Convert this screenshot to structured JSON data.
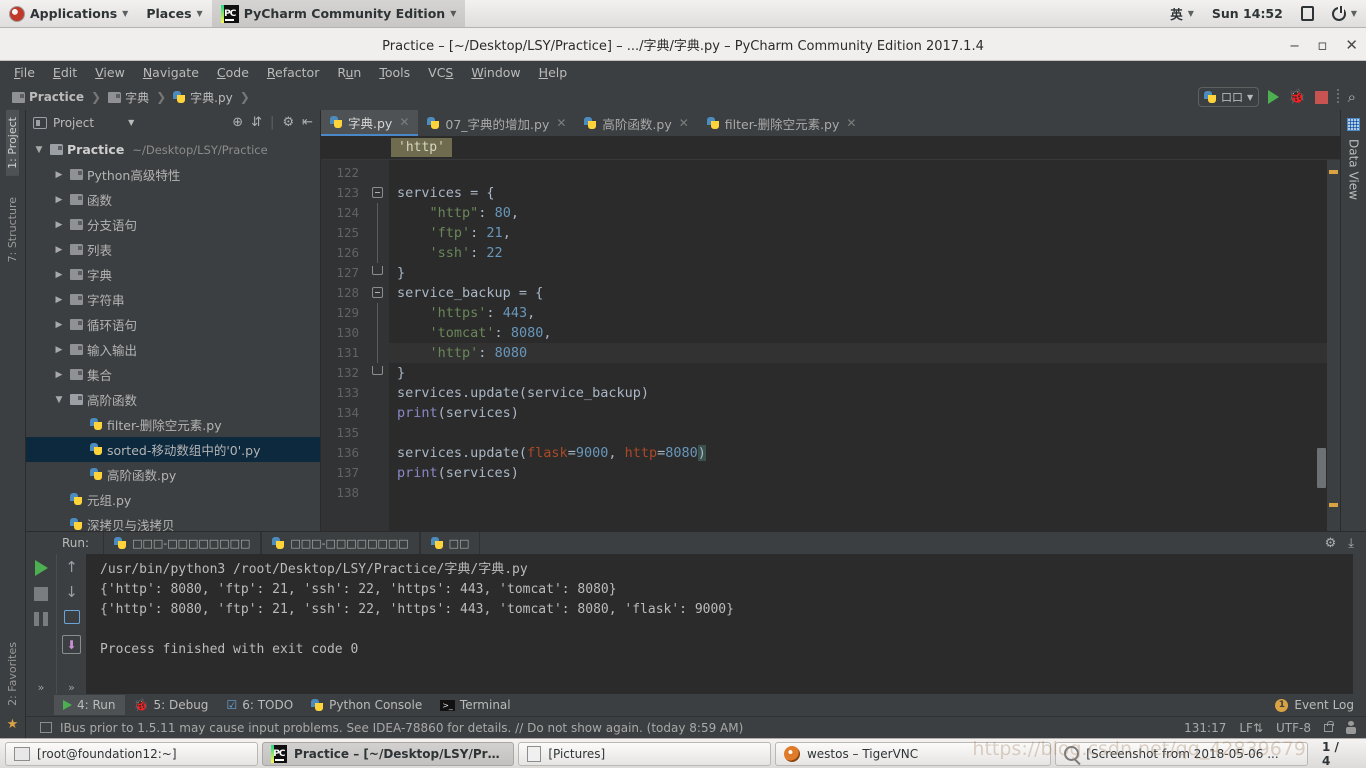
{
  "gnome_panel": {
    "applications": "Applications",
    "places": "Places",
    "app_name": "PyCharm Community Edition",
    "input_method": "英",
    "clock": "Sun 14:52"
  },
  "window": {
    "title": "Practice – [~/Desktop/LSY/Practice] – .../字典/字典.py – PyCharm Community Edition 2017.1.4",
    "minimize": "‒",
    "maximize": "▫",
    "close": "✕"
  },
  "menu": [
    {
      "label": "File",
      "accel": "F"
    },
    {
      "label": "Edit",
      "accel": "E"
    },
    {
      "label": "View",
      "accel": "V"
    },
    {
      "label": "Navigate",
      "accel": "N"
    },
    {
      "label": "Code",
      "accel": "C"
    },
    {
      "label": "Refactor",
      "accel": "R"
    },
    {
      "label": "Run",
      "accel": "u"
    },
    {
      "label": "Tools",
      "accel": "T"
    },
    {
      "label": "VCS",
      "accel": "S"
    },
    {
      "label": "Window",
      "accel": "W"
    },
    {
      "label": "Help",
      "accel": "H"
    }
  ],
  "navbar": {
    "crumbs": [
      "Practice",
      "字典",
      "字典.py"
    ],
    "separator": "❯",
    "run_config": "口口"
  },
  "left_strip": {
    "project": "1: Project",
    "structure": "7: Structure",
    "favorites": "2: Favorites"
  },
  "right_strip": {
    "data_view": "Data View"
  },
  "project_panel": {
    "title": "Project",
    "tree": [
      {
        "depth": 0,
        "arrow": "▼",
        "icon": "folder-open-icon",
        "label": "Practice",
        "suffix": "~/Desktop/LSY/Practice",
        "bold": true,
        "selected": false
      },
      {
        "depth": 1,
        "arrow": "▶",
        "icon": "folder-icon",
        "label": "Python高级特性",
        "suffix": "",
        "bold": false,
        "selected": false
      },
      {
        "depth": 1,
        "arrow": "▶",
        "icon": "folder-icon",
        "label": "函数",
        "suffix": "",
        "bold": false,
        "selected": false
      },
      {
        "depth": 1,
        "arrow": "▶",
        "icon": "folder-icon",
        "label": "分支语句",
        "suffix": "",
        "bold": false,
        "selected": false
      },
      {
        "depth": 1,
        "arrow": "▶",
        "icon": "folder-icon",
        "label": "列表",
        "suffix": "",
        "bold": false,
        "selected": false
      },
      {
        "depth": 1,
        "arrow": "▶",
        "icon": "folder-icon",
        "label": "字典",
        "suffix": "",
        "bold": false,
        "selected": false
      },
      {
        "depth": 1,
        "arrow": "▶",
        "icon": "folder-icon",
        "label": "字符串",
        "suffix": "",
        "bold": false,
        "selected": false
      },
      {
        "depth": 1,
        "arrow": "▶",
        "icon": "folder-icon",
        "label": "循环语句",
        "suffix": "",
        "bold": false,
        "selected": false
      },
      {
        "depth": 1,
        "arrow": "▶",
        "icon": "folder-icon",
        "label": "输入输出",
        "suffix": "",
        "bold": false,
        "selected": false
      },
      {
        "depth": 1,
        "arrow": "▶",
        "icon": "folder-icon",
        "label": "集合",
        "suffix": "",
        "bold": false,
        "selected": false
      },
      {
        "depth": 1,
        "arrow": "▼",
        "icon": "folder-open-icon",
        "label": "高阶函数",
        "suffix": "",
        "bold": false,
        "selected": false
      },
      {
        "depth": 2,
        "arrow": "",
        "icon": "python-file-icon",
        "label": "filter-删除空元素.py",
        "suffix": "",
        "bold": false,
        "selected": false
      },
      {
        "depth": 2,
        "arrow": "",
        "icon": "python-file-icon",
        "label": "sorted-移动数组中的'0'.py",
        "suffix": "",
        "bold": false,
        "selected": true
      },
      {
        "depth": 2,
        "arrow": "",
        "icon": "python-file-icon",
        "label": "高阶函数.py",
        "suffix": "",
        "bold": false,
        "selected": false
      },
      {
        "depth": 1,
        "arrow": "",
        "icon": "python-file-icon",
        "label": "元组.py",
        "suffix": "",
        "bold": false,
        "selected": false
      },
      {
        "depth": 1,
        "arrow": "",
        "icon": "python-file-icon",
        "label": "深拷贝与浅拷贝",
        "suffix": "",
        "bold": false,
        "selected": false
      }
    ]
  },
  "editor_tabs": [
    {
      "label": "字典.py",
      "selected": true
    },
    {
      "label": "07_字典的增加.py",
      "selected": false
    },
    {
      "label": "高阶函数.py",
      "selected": false
    },
    {
      "label": "filter-删除空元素.py",
      "selected": false
    }
  ],
  "editor_breadcrumb": "'http'",
  "code": {
    "first_line": 122,
    "lines": [
      {
        "n": 122,
        "text": "",
        "highlight": false,
        "fold": "",
        "bulb": false
      },
      {
        "n": 123,
        "text": "services = {",
        "highlight": false,
        "fold": "start",
        "bulb": false
      },
      {
        "n": 124,
        "text": "    \"http\": 80,",
        "highlight": false,
        "fold": "bar",
        "bulb": false
      },
      {
        "n": 125,
        "text": "    'ftp': 21,",
        "highlight": false,
        "fold": "bar",
        "bulb": false
      },
      {
        "n": 126,
        "text": "    'ssh': 22",
        "highlight": false,
        "fold": "bar",
        "bulb": false
      },
      {
        "n": 127,
        "text": "}",
        "highlight": false,
        "fold": "end",
        "bulb": false
      },
      {
        "n": 128,
        "text": "service_backup = {",
        "highlight": false,
        "fold": "start",
        "bulb": false
      },
      {
        "n": 129,
        "text": "    'https': 443,",
        "highlight": false,
        "fold": "bar",
        "bulb": false
      },
      {
        "n": 130,
        "text": "    'tomcat': 8080,",
        "highlight": false,
        "fold": "bar",
        "bulb": false
      },
      {
        "n": 131,
        "text": "    'http': 8080",
        "highlight": true,
        "fold": "bar",
        "bulb": true
      },
      {
        "n": 132,
        "text": "}",
        "highlight": false,
        "fold": "end",
        "bulb": false
      },
      {
        "n": 133,
        "text": "services.update(service_backup)",
        "highlight": false,
        "fold": "",
        "bulb": false
      },
      {
        "n": 134,
        "text": "print(services)",
        "highlight": false,
        "fold": "",
        "bulb": false
      },
      {
        "n": 135,
        "text": "",
        "highlight": false,
        "fold": "",
        "bulb": false
      },
      {
        "n": 136,
        "text": "services.update(flask=9000, http=8080)",
        "highlight": false,
        "fold": "",
        "bulb": false
      },
      {
        "n": 137,
        "text": "print(services)",
        "highlight": false,
        "fold": "",
        "bulb": false
      },
      {
        "n": 138,
        "text": "",
        "highlight": false,
        "fold": "",
        "bulb": false
      }
    ]
  },
  "run_window": {
    "label": "Run:",
    "tabs": [
      {
        "label": "□□□-□□□□□□□□",
        "boxes": 11
      },
      {
        "label": "□□□-□□□□□□□□",
        "boxes": 11
      },
      {
        "label": "□□",
        "boxes": 2
      }
    ],
    "console": [
      "/usr/bin/python3 /root/Desktop/LSY/Practice/字典/字典.py",
      "{'http': 8080, 'ftp': 21, 'ssh': 22, 'https': 443, 'tomcat': 8080}",
      "{'http': 8080, 'ftp': 21, 'ssh': 22, 'https': 443, 'tomcat': 8080, 'flask': 9000}",
      "",
      "Process finished with exit code 0"
    ]
  },
  "bottom_tabs": [
    {
      "label": "4: Run",
      "accel": "4",
      "icon": "run-icon",
      "selected": true
    },
    {
      "label": "5: Debug",
      "accel": "5",
      "icon": "debug-icon",
      "selected": false
    },
    {
      "label": "6: TODO",
      "accel": "6",
      "icon": "todo-icon",
      "selected": false
    },
    {
      "label": "Python Console",
      "accel": "",
      "icon": "python-icon",
      "selected": false
    },
    {
      "label": "Terminal",
      "accel": "",
      "icon": "terminal-icon",
      "selected": false
    }
  ],
  "event_log": {
    "label": "Event Log",
    "badge": "1"
  },
  "status_bar": {
    "message": "IBus prior to 1.5.11 may cause input problems. See IDEA-78860 for details. // Do not show again. (today 8:59 AM)",
    "caret": "131:17",
    "line_sep": "LF",
    "encoding": "UTF-8"
  },
  "taskbar": {
    "items": [
      {
        "label": "[root@foundation12:~]",
        "icon": "terminal-icon",
        "active": false
      },
      {
        "label": "Practice – [~/Desktop/LSY/Practi...",
        "icon": "pycharm-icon",
        "active": true
      },
      {
        "label": "[Pictures]",
        "icon": "folder-icon",
        "active": false
      },
      {
        "label": "westos – TigerVNC",
        "icon": "vnc-icon",
        "active": false
      },
      {
        "label": "[Screenshot from 2018-05-06 ...",
        "icon": "magnifier-icon",
        "active": false
      }
    ],
    "page_count": "1 / 4"
  },
  "watermark": "https://blog.csdn.net/qq_42839679",
  "colors": {
    "accent": "#4a88c7",
    "selection": "#0d293e",
    "editor_bg": "#2b2b2b",
    "panel_bg": "#3c3f41",
    "string": "#6a8759",
    "number": "#6897bb",
    "keyword": "#cc7832"
  }
}
